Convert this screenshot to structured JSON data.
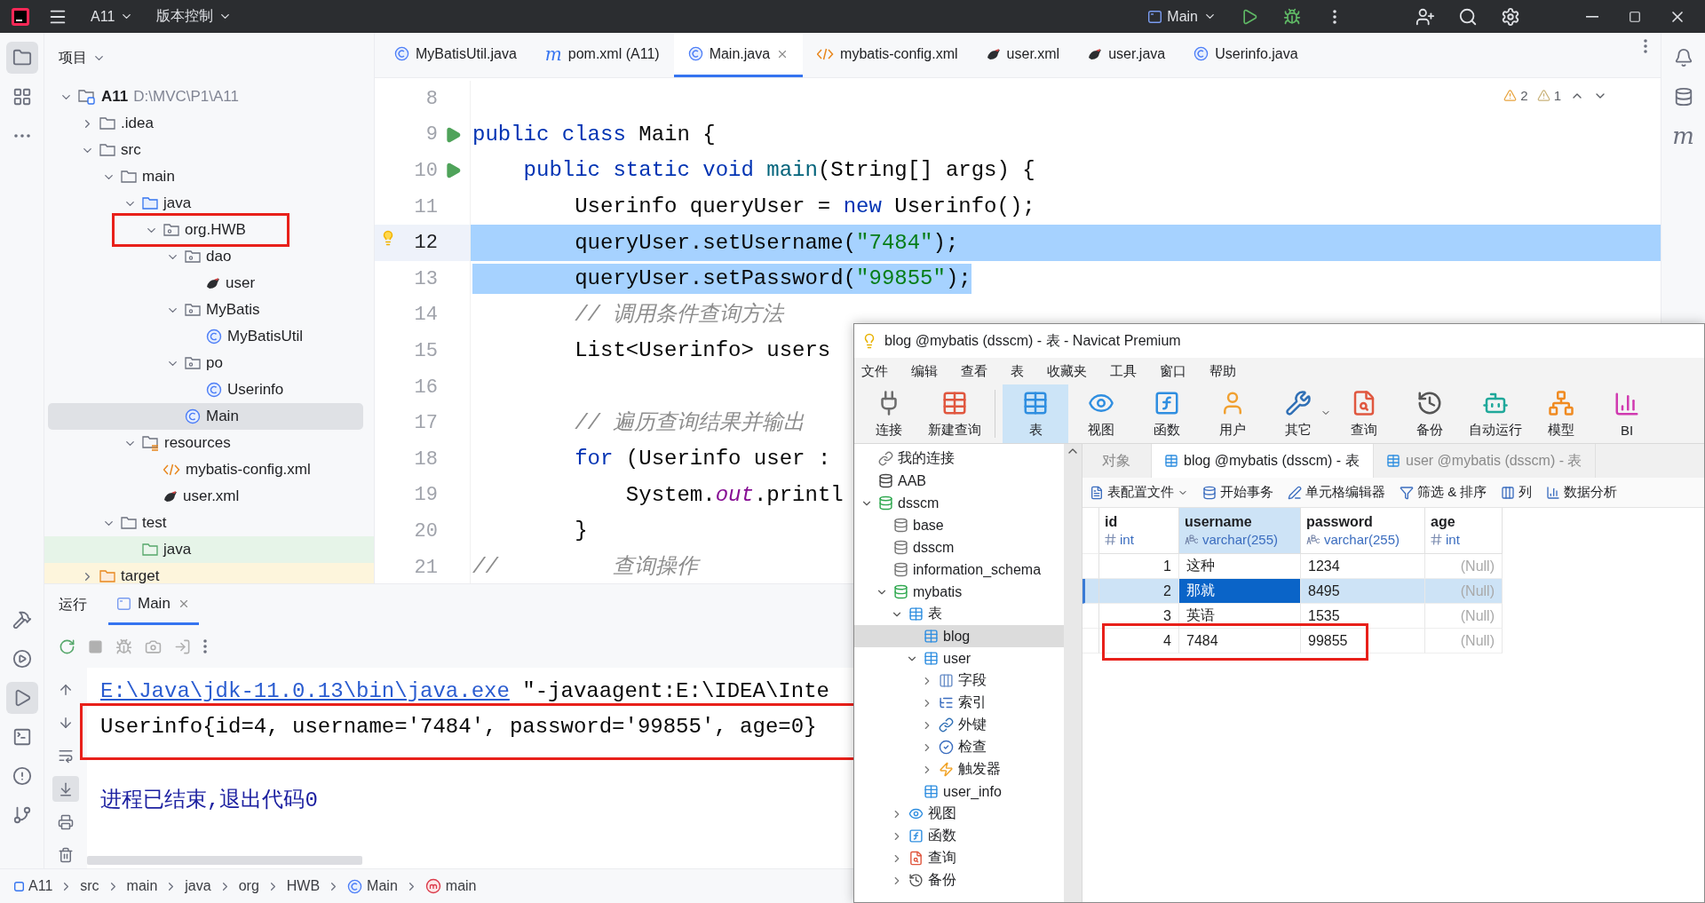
{
  "ide": {
    "top_bar": {
      "project": "A11",
      "vcs": "版本控制",
      "run_config": "Main"
    },
    "left_tools": [
      {
        "kind": "project",
        "selected": true
      },
      {
        "kind": "structure",
        "selected": false
      },
      {
        "kind": "more",
        "selected": false
      }
    ],
    "left_tools_bottom": [
      {
        "kind": "build",
        "selected": false
      },
      {
        "kind": "services",
        "selected": false
      },
      {
        "kind": "run",
        "selected": true
      },
      {
        "kind": "terminal",
        "selected": false
      },
      {
        "kind": "problems",
        "selected": false
      },
      {
        "kind": "git",
        "selected": false
      }
    ],
    "right_tools": [
      {
        "kind": "notifications"
      },
      {
        "kind": "database"
      },
      {
        "kind": "maven",
        "glyph": "m"
      }
    ],
    "project_panel": {
      "title": "项目",
      "tree": [
        {
          "label": "A11",
          "path": "D:\\MVC\\P1\\A11",
          "kind": "module",
          "expanded": true,
          "selected": false,
          "children": [
            {
              "label": ".idea",
              "kind": "folder",
              "expanded": false,
              "selected": false
            },
            {
              "label": "src",
              "kind": "folder",
              "expanded": true,
              "selected": false,
              "children": [
                {
                  "label": "main",
                  "kind": "folder",
                  "expanded": true,
                  "selected": false,
                  "children": [
                    {
                      "label": "java",
                      "kind": "source_root",
                      "expanded": true,
                      "selected": false,
                      "children": [
                        {
                          "label": "org.HWB",
                          "kind": "package",
                          "expanded": true,
                          "selected": false,
                          "marked": true,
                          "children": [
                            {
                              "label": "dao",
                              "kind": "package",
                              "expanded": true,
                              "selected": false,
                              "children": [
                                {
                                  "label": "user",
                                  "kind": "mapper",
                                  "selected": false
                                }
                              ]
                            },
                            {
                              "label": "MyBatis",
                              "kind": "package",
                              "expanded": true,
                              "selected": false,
                              "children": [
                                {
                                  "label": "MyBatisUtil",
                                  "kind": "class",
                                  "selected": false
                                }
                              ]
                            },
                            {
                              "label": "po",
                              "kind": "package",
                              "expanded": true,
                              "selected": false,
                              "children": [
                                {
                                  "label": "Userinfo",
                                  "kind": "class",
                                  "selected": false
                                }
                              ]
                            },
                            {
                              "label": "Main",
                              "kind": "class",
                              "selected": true
                            }
                          ]
                        }
                      ]
                    },
                    {
                      "label": "resources",
                      "kind": "resources_root",
                      "expanded": true,
                      "selected": false,
                      "children": [
                        {
                          "label": "mybatis-config.xml",
                          "kind": "xml",
                          "selected": false
                        },
                        {
                          "label": "user.xml",
                          "kind": "mapper",
                          "selected": false
                        }
                      ]
                    }
                  ]
                },
                {
                  "label": "test",
                  "kind": "folder",
                  "expanded": true,
                  "selected": false,
                  "children": [
                    {
                      "label": "java",
                      "kind": "test_root",
                      "selected": false
                    }
                  ]
                }
              ]
            },
            {
              "label": "target",
              "kind": "excluded",
              "expanded": false,
              "selected": false
            }
          ]
        }
      ]
    },
    "editor": {
      "tabs": [
        {
          "label": "MyBatisUtil.java",
          "kind": "class",
          "selected": false
        },
        {
          "label": "pom.xml (A11)",
          "kind": "maven",
          "glyph": "m",
          "selected": false
        },
        {
          "label": "Main.java",
          "kind": "class",
          "selected": true
        },
        {
          "label": "mybatis-config.xml",
          "kind": "xml",
          "selected": false
        },
        {
          "label": "user.xml",
          "kind": "mapper",
          "selected": false
        },
        {
          "label": "user.java",
          "kind": "mapper",
          "selected": false
        },
        {
          "label": "Userinfo.java",
          "kind": "class",
          "selected": false
        }
      ],
      "warnings": "2",
      "weak_warnings": "1",
      "lines": [
        {
          "number": "8"
        },
        {
          "number": "9",
          "selected": false,
          "run": true,
          "tokens": [
            {
              "kind": "keyword",
              "t": "public class "
            },
            {
              "kind": "plain",
              "t": "Main {"
            }
          ]
        },
        {
          "number": "10",
          "selected": false,
          "run": true,
          "tokens": [
            {
              "kind": "keyword",
              "t": "    public static void "
            },
            {
              "kind": "method",
              "t": "main"
            },
            {
              "kind": "plain",
              "t": "(String[] args) {"
            }
          ]
        },
        {
          "number": "11",
          "selected": false,
          "tokens": [
            {
              "kind": "plain",
              "t": "        Userinfo queryUser = "
            },
            {
              "kind": "keyword",
              "t": "new "
            },
            {
              "kind": "plain",
              "t": "Userinfo();"
            }
          ]
        },
        {
          "number": "12",
          "selected": true,
          "selected_to_end": true,
          "current": true,
          "bulb": true,
          "tokens": [
            {
              "kind": "plain",
              "t": "        queryUser.setUsername("
            },
            {
              "kind": "string",
              "t": "\"7484\""
            },
            {
              "kind": "plain",
              "t": ");"
            }
          ]
        },
        {
          "number": "13",
          "selected": true,
          "tokens": [
            {
              "kind": "plain",
              "t": "        queryUser.setPassword("
            },
            {
              "kind": "string",
              "t": "\"99855\""
            },
            {
              "kind": "plain",
              "t": ");"
            }
          ]
        },
        {
          "number": "14",
          "selected": false,
          "tokens": [
            {
              "kind": "comment",
              "t": "        // 调用条件查询方法"
            }
          ]
        },
        {
          "number": "15",
          "selected": false,
          "tokens": [
            {
              "kind": "plain",
              "t": "        List<Userinfo> users"
            }
          ]
        },
        {
          "number": "16"
        },
        {
          "number": "17",
          "selected": false,
          "tokens": [
            {
              "kind": "comment",
              "t": "        // 遍历查询结果并输出"
            }
          ]
        },
        {
          "number": "18",
          "selected": false,
          "tokens": [
            {
              "kind": "keyword",
              "t": "        for"
            },
            {
              "kind": "plain",
              "t": " (Userinfo user :"
            }
          ]
        },
        {
          "number": "19",
          "selected": false,
          "tokens": [
            {
              "kind": "plain",
              "t": "            System."
            },
            {
              "kind": "field",
              "t": "out"
            },
            {
              "kind": "plain",
              "t": ".printl"
            }
          ]
        },
        {
          "number": "20",
          "selected": false,
          "tokens": [
            {
              "kind": "plain",
              "t": "        }"
            }
          ]
        },
        {
          "number": "21",
          "selected": false,
          "tokens": [
            {
              "kind": "comment",
              "t": "//         查询操作"
            }
          ]
        }
      ]
    },
    "run_panel": {
      "title": "运行",
      "tabs": [
        {
          "label": "Main",
          "selected": true
        }
      ],
      "console": [
        {
          "kind": "command",
          "link": "E:\\Java\\jdk-11.0.13\\bin\\java.exe",
          "text": " \"-javaagent:E:\\IDEA\\Inte"
        },
        {
          "kind": "output",
          "text": "Userinfo{id=4, username='7484', password='99855', age=0}",
          "marked": true
        },
        {
          "kind": "exit",
          "text": "进程已结束,退出代码0"
        }
      ]
    },
    "breadcrumb": [
      {
        "label": "A11",
        "kind": "module"
      },
      {
        "label": "src",
        "kind": "plain"
      },
      {
        "label": "main",
        "kind": "plain"
      },
      {
        "label": "java",
        "kind": "plain"
      },
      {
        "label": "org",
        "kind": "plain"
      },
      {
        "label": "HWB",
        "kind": "plain"
      },
      {
        "label": "Main",
        "kind": "class"
      },
      {
        "label": "main",
        "kind": "method"
      }
    ]
  },
  "navicat": {
    "title": "blog @mybatis (dsscm) - 表 - Navicat Premium",
    "menu": [
      "文件",
      "编辑",
      "查看",
      "表",
      "收藏夹",
      "工具",
      "窗口",
      "帮助"
    ],
    "toolbar": [
      {
        "label": "连接",
        "kind": "connect",
        "selected": false
      },
      {
        "label": "新建查询",
        "kind": "new_query",
        "selected": false
      },
      {
        "label": "表",
        "kind": "table",
        "selected": true,
        "separator_before": true
      },
      {
        "label": "视图",
        "kind": "view",
        "selected": false
      },
      {
        "label": "函数",
        "kind": "function",
        "selected": false
      },
      {
        "label": "用户",
        "kind": "user",
        "selected": false
      },
      {
        "label": "其它",
        "kind": "other",
        "selected": false,
        "dropdown": true
      },
      {
        "label": "查询",
        "kind": "query",
        "selected": false
      },
      {
        "label": "备份",
        "kind": "backup",
        "selected": false
      },
      {
        "label": "自动运行",
        "kind": "robot",
        "selected": false
      },
      {
        "label": "模型",
        "kind": "model",
        "selected": false
      },
      {
        "label": "BI",
        "kind": "bi",
        "selected": false
      }
    ],
    "tree": [
      {
        "label": "我的连接",
        "kind": "group",
        "selected": false
      },
      {
        "label": "AAB",
        "kind": "connection_off",
        "selected": false
      },
      {
        "label": "dsscm",
        "kind": "connection",
        "expanded": true,
        "selected": false,
        "children": [
          {
            "label": "base",
            "kind": "database",
            "selected": false
          },
          {
            "label": "dsscm",
            "kind": "database",
            "selected": false
          },
          {
            "label": "information_schema",
            "kind": "database",
            "selected": false
          },
          {
            "label": "mybatis",
            "kind": "database_open",
            "expanded": true,
            "selected": false,
            "children": [
              {
                "label": "表",
                "kind": "tables",
                "expanded": true,
                "selected": false,
                "children": [
                  {
                    "label": "blog",
                    "kind": "table",
                    "selected": true
                  },
                  {
                    "label": "user",
                    "kind": "table",
                    "expanded": true,
                    "selected": false,
                    "children": [
                      {
                        "label": "字段",
                        "kind": "fields",
                        "expanded": false,
                        "selected": false
                      },
                      {
                        "label": "索引",
                        "kind": "index",
                        "expanded": false,
                        "selected": false
                      },
                      {
                        "label": "外键",
                        "kind": "foreign_key",
                        "expanded": false,
                        "selected": false
                      },
                      {
                        "label": "检查",
                        "kind": "check",
                        "expanded": false,
                        "selected": false
                      },
                      {
                        "label": "触发器",
                        "kind": "trigger",
                        "expanded": false,
                        "selected": false
                      }
                    ]
                  },
                  {
                    "label": "user_info",
                    "kind": "table",
                    "selected": false
                  }
                ]
              },
              {
                "label": "视图",
                "kind": "views",
                "expanded": false,
                "selected": false
              },
              {
                "label": "函数",
                "kind": "functions",
                "expanded": false,
                "selected": false
              },
              {
                "label": "查询",
                "kind": "queries",
                "expanded": false,
                "selected": false
              },
              {
                "label": "备份",
                "kind": "backups",
                "expanded": false,
                "selected": false
              }
            ]
          }
        ]
      }
    ],
    "tabs": [
      {
        "label": "对象",
        "kind": "objects",
        "selected": false
      },
      {
        "label": "blog @mybatis (dsscm) - 表",
        "kind": "table",
        "selected": true
      },
      {
        "label": "user @mybatis (dsscm) - 表",
        "kind": "table",
        "selected": false
      }
    ],
    "actions": [
      {
        "label": "表配置文件",
        "kind": "profile",
        "dropdown": true
      },
      {
        "label": "开始事务",
        "kind": "transaction"
      },
      {
        "label": "单元格编辑器",
        "kind": "cell_editor"
      },
      {
        "label": "筛选 & 排序",
        "kind": "filter"
      },
      {
        "label": "列",
        "kind": "columns"
      },
      {
        "label": "数据分析",
        "kind": "analysis"
      }
    ],
    "grid": {
      "columns": [
        {
          "name": "id",
          "type": "int",
          "kind": "number",
          "selected": false
        },
        {
          "name": "username",
          "type": "varchar(255)",
          "kind": "text",
          "selected": true
        },
        {
          "name": "password",
          "type": "varchar(255)",
          "kind": "text",
          "selected": false
        },
        {
          "name": "age",
          "type": "int",
          "kind": "number",
          "selected": false
        }
      ],
      "rows": [
        {
          "selected": false,
          "cells": [
            {
              "text": "1"
            },
            {
              "text": "这种"
            },
            {
              "text": "1234"
            },
            {
              "text": "(Null)",
              "null": true
            }
          ]
        },
        {
          "selected": true,
          "cells": [
            {
              "text": "2"
            },
            {
              "text": "那就"
            },
            {
              "text": "8495"
            },
            {
              "text": "(Null)",
              "null": true
            }
          ]
        },
        {
          "selected": false,
          "cells": [
            {
              "text": "3"
            },
            {
              "text": "英语"
            },
            {
              "text": "1535"
            },
            {
              "text": "(Null)",
              "null": true
            }
          ]
        },
        {
          "selected": false,
          "marked": true,
          "cells": [
            {
              "text": "4"
            },
            {
              "text": "7484"
            },
            {
              "text": "99855"
            },
            {
              "text": "(Null)",
              "null": true
            }
          ]
        }
      ]
    }
  }
}
